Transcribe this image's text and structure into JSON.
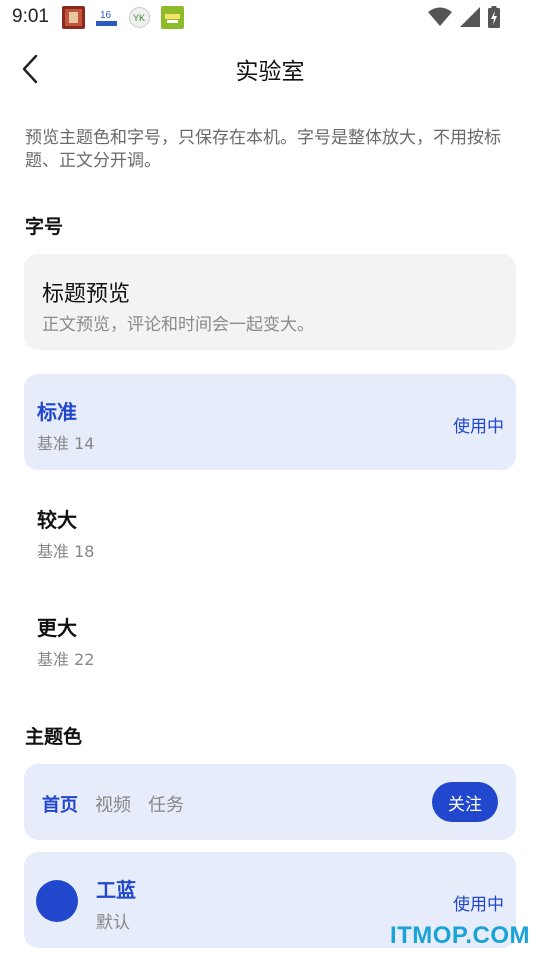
{
  "status_bar": {
    "time": "9:01",
    "notification_icons": [
      "app-notification-icon-red",
      "app-notification-icon-16",
      "app-notification-icon-yk",
      "app-notification-icon-green"
    ],
    "right_icons": [
      "wifi-icon",
      "signal-icon",
      "battery-charging-icon"
    ]
  },
  "header": {
    "title": "实验室",
    "back_icon": "chevron-left-icon"
  },
  "description": "预览主题色和字号，只保存在本机。字号是整体放大，不用按标题、正文分开调。",
  "font_size_section": {
    "label": "字号",
    "preview": {
      "title": "标题预览",
      "body": "正文预览，评论和时间会一起变大。"
    },
    "options": [
      {
        "name": "标准",
        "sub": "基准 14",
        "status": "使用中",
        "selected": true
      },
      {
        "name": "较大",
        "sub": "基准 18",
        "status": "",
        "selected": false
      },
      {
        "name": "更大",
        "sub": "基准 22",
        "status": "",
        "selected": false
      }
    ]
  },
  "theme_section": {
    "label": "主题色",
    "preview_tabs": [
      "首页",
      "视频",
      "任务"
    ],
    "active_tab": "首页",
    "follow_label": "关注",
    "options": [
      {
        "name": "工蓝",
        "sub": "默认",
        "status": "使用中",
        "color": "#2047cc",
        "selected": true
      }
    ]
  },
  "colors": {
    "accent": "#2047cc",
    "selected_bg": "#e7ecfa",
    "card_bg": "#f3f3f3"
  },
  "watermark": "ITMOP.COM"
}
